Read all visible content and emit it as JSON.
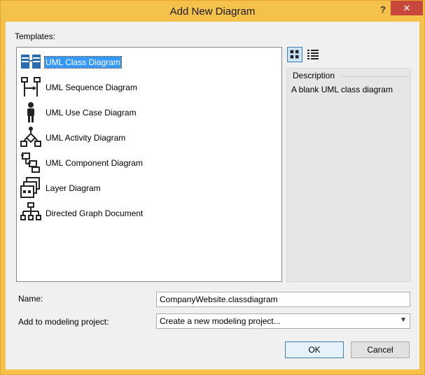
{
  "window": {
    "title": "Add New Diagram",
    "help": "?",
    "close": "✕"
  },
  "templates": {
    "label": "Templates:",
    "items": [
      {
        "label": "UML Class Diagram",
        "icon": "class-diagram-icon",
        "selected": true
      },
      {
        "label": "UML Sequence Diagram",
        "icon": "sequence-diagram-icon"
      },
      {
        "label": "UML Use Case Diagram",
        "icon": "use-case-diagram-icon"
      },
      {
        "label": "UML Activity Diagram",
        "icon": "activity-diagram-icon"
      },
      {
        "label": "UML Component Diagram",
        "icon": "component-diagram-icon"
      },
      {
        "label": "Layer Diagram",
        "icon": "layer-diagram-icon"
      },
      {
        "label": "Directed Graph Document",
        "icon": "directed-graph-icon"
      }
    ]
  },
  "view_buttons": {
    "large": "large-icons-view-icon",
    "list": "list-view-icon"
  },
  "description": {
    "title": "Description",
    "text": "A blank UML class diagram"
  },
  "name": {
    "label": "Name:",
    "value": "CompanyWebsite.classdiagram"
  },
  "project": {
    "label": "Add to modeling project:",
    "value": "Create a new modeling project..."
  },
  "buttons": {
    "ok": "OK",
    "cancel": "Cancel"
  },
  "colors": {
    "selection": "#3399ff",
    "frame": "#f4c14b",
    "close": "#c7473a"
  }
}
